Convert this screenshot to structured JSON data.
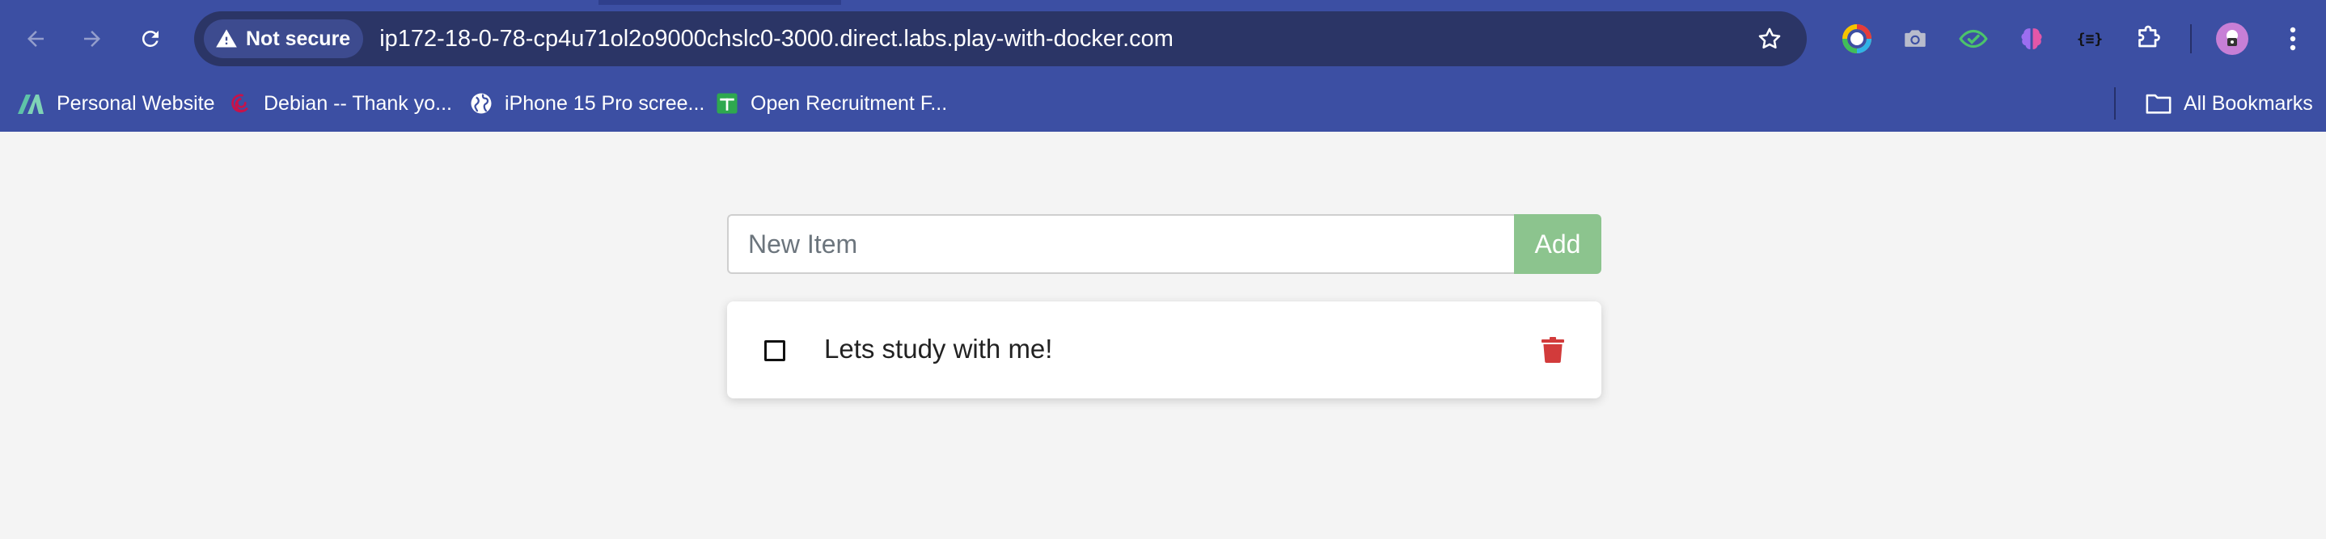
{
  "browser": {
    "security_label": "Not secure",
    "url": "ip172-18-0-78-cp4u71ol2o9000chslc0-3000.direct.labs.play-with-docker.com",
    "nav": {
      "back_icon": "arrow-left-icon",
      "forward_icon": "arrow-right-icon",
      "reload_icon": "reload-icon"
    },
    "bookmarks": [
      {
        "label": "Personal Website",
        "icon": "personal-website-logo-icon"
      },
      {
        "label": "Debian -- Thank yo...",
        "icon": "debian-swirl-icon"
      },
      {
        "label": "iPhone 15 Pro scree...",
        "icon": "globe-icon"
      },
      {
        "label": "Open Recruitment F...",
        "icon": "google-forms-icon"
      }
    ],
    "all_bookmarks_label": "All Bookmarks",
    "colors": {
      "chrome_bg": "#3c4fa3",
      "omnibox_bg": "#2b3566"
    }
  },
  "app": {
    "new_item_placeholder": "New Item",
    "add_button_label": "Add",
    "items": [
      {
        "name": "Lets study with me!",
        "completed": false
      }
    ],
    "colors": {
      "add_button": "#8cc48e",
      "delete_icon": "#d23b3b",
      "page_bg": "#f4f4f4"
    }
  }
}
